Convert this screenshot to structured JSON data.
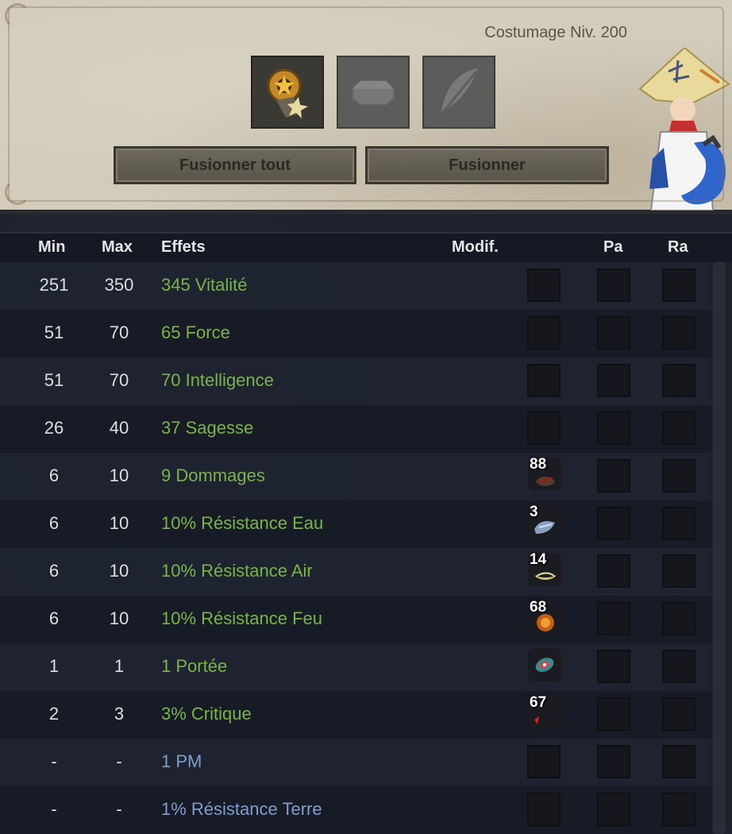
{
  "header": {
    "level_label": "Costumage Niv. 200",
    "fuse_all_label": "Fusionner tout",
    "fuse_label": "Fusionner"
  },
  "slots": [
    {
      "icon": "gear-costume-icon",
      "active": true
    },
    {
      "icon": "octagon-slot-icon",
      "active": false
    },
    {
      "icon": "feather-slot-icon",
      "active": false
    }
  ],
  "columns": {
    "min": "Min",
    "max": "Max",
    "effects": "Effets",
    "modif": "Modif.",
    "pa": "Pa",
    "ra": "Ra"
  },
  "rows": [
    {
      "min": "251",
      "max": "350",
      "effect": "345 Vitalité",
      "color": "green",
      "rune": null
    },
    {
      "min": "51",
      "max": "70",
      "effect": "65 Force",
      "color": "green",
      "rune": null
    },
    {
      "min": "51",
      "max": "70",
      "effect": "70 Intelligence",
      "color": "green",
      "rune": null
    },
    {
      "min": "26",
      "max": "40",
      "effect": "37 Sagesse",
      "color": "green",
      "rune": null
    },
    {
      "min": "6",
      "max": "10",
      "effect": "9 Dommages",
      "color": "green",
      "rune": {
        "count": "88",
        "icon": "damage-rune-icon"
      }
    },
    {
      "min": "6",
      "max": "10",
      "effect": "10% Résistance Eau",
      "color": "green",
      "rune": {
        "count": "3",
        "icon": "water-rune-icon"
      }
    },
    {
      "min": "6",
      "max": "10",
      "effect": "10% Résistance Air",
      "color": "green",
      "rune": {
        "count": "14",
        "icon": "air-rune-icon"
      }
    },
    {
      "min": "6",
      "max": "10",
      "effect": "10% Résistance Feu",
      "color": "green",
      "rune": {
        "count": "68",
        "icon": "fire-rune-icon"
      }
    },
    {
      "min": "1",
      "max": "1",
      "effect": "1 Portée",
      "color": "green",
      "rune": {
        "count": "",
        "icon": "range-rune-icon"
      }
    },
    {
      "min": "2",
      "max": "3",
      "effect": "3% Critique",
      "color": "green",
      "rune": {
        "count": "67",
        "icon": "critical-rune-icon"
      }
    },
    {
      "min": "-",
      "max": "-",
      "effect": "1 PM",
      "color": "blue",
      "rune": null
    },
    {
      "min": "-",
      "max": "-",
      "effect": "1% Résistance Terre",
      "color": "blue",
      "rune": null
    }
  ],
  "colors": {
    "green_effect": "#78b548",
    "blue_effect": "#7d9ed0",
    "parchment": "#d3ccbb"
  }
}
